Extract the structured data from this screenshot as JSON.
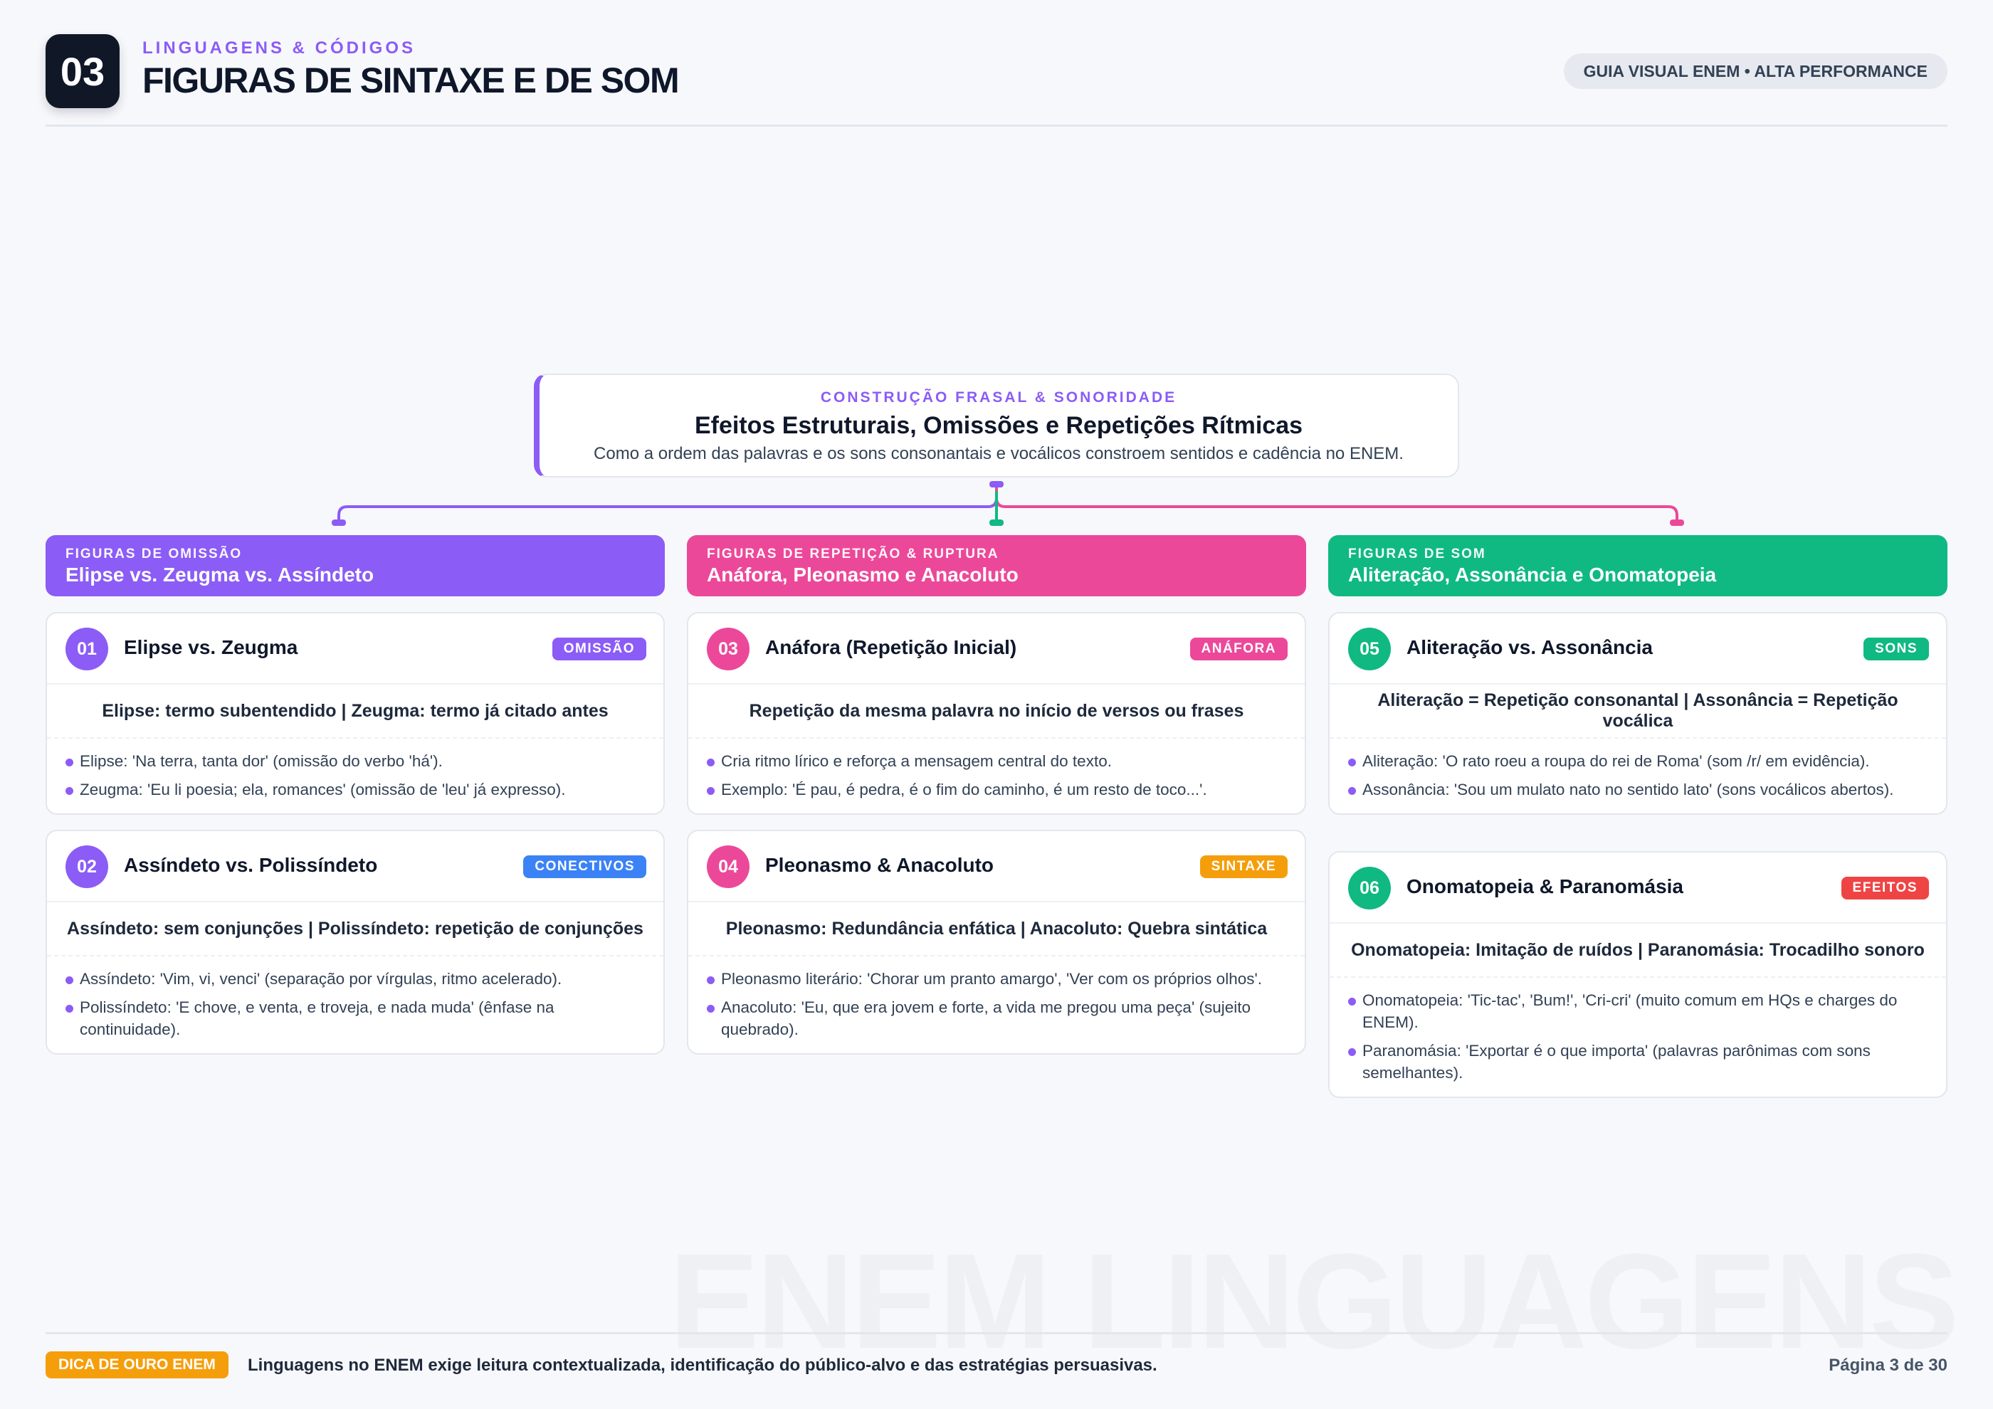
{
  "header": {
    "chapter_number": "03",
    "kicker": "LINGUAGENS & CÓDIGOS",
    "title": "FIGURAS DE SINTAXE E DE SOM",
    "guide_label": "GUIA VISUAL ENEM • ALTA PERFORMANCE"
  },
  "hero": {
    "kicker": "CONSTRUÇÃO FRASAL & SONORIDADE",
    "title": "Efeitos Estruturais, Omissões e Repetições Rítmicas",
    "description": "Como a ordem das palavras e os sons consonantais e vocálicos constroem sentidos e cadência no ENEM."
  },
  "colors": {
    "purple": "#8b5cf6",
    "pink": "#ec4899",
    "green": "#10b981",
    "blue": "#3b82f6",
    "orange": "#f59e0b",
    "red": "#ef4444"
  },
  "columns": [
    {
      "kicker": "FIGURAS DE OMISSÃO",
      "title": "Elipse vs. Zeugma vs. Assíndeto",
      "cards": [
        {
          "number": "01",
          "title": "Elipse vs. Zeugma",
          "tag": "OMISSÃO",
          "subtitle": "Elipse: termo subentendido | Zeugma: termo já citado antes",
          "bullets": [
            "Elipse: 'Na terra, tanta dor' (omissão do verbo 'há').",
            "Zeugma: 'Eu li poesia; ela, romances' (omissão de 'leu' já expresso)."
          ]
        },
        {
          "number": "02",
          "title": "Assíndeto vs. Polissíndeto",
          "tag": "CONECTIVOS",
          "subtitle": "Assíndeto: sem conjunções | Polissíndeto: repetição de conjunções",
          "bullets": [
            "Assíndeto: 'Vim, vi, venci' (separação por vírgulas, ritmo acelerado).",
            "Polissíndeto: 'E chove, e venta, e troveja, e nada muda' (ênfase na continuidade)."
          ]
        }
      ]
    },
    {
      "kicker": "FIGURAS DE REPETIÇÃO & RUPTURA",
      "title": "Anáfora, Pleonasmo e Anacoluto",
      "cards": [
        {
          "number": "03",
          "title": "Anáfora (Repetição Inicial)",
          "tag": "ANÁFORA",
          "subtitle": "Repetição da mesma palavra no início de versos ou frases",
          "bullets": [
            "Cria ritmo lírico e reforça a mensagem central do texto.",
            "Exemplo: 'É pau, é pedra, é o fim do caminho, é um resto de toco...'."
          ]
        },
        {
          "number": "04",
          "title": "Pleonasmo & Anacoluto",
          "tag": "SINTAXE",
          "subtitle": "Pleonasmo: Redundância enfática | Anacoluto: Quebra sintática",
          "bullets": [
            "Pleonasmo literário: 'Chorar um pranto amargo', 'Ver com os próprios olhos'.",
            "Anacoluto: 'Eu, que era jovem e forte, a vida me pregou uma peça' (sujeito quebrado)."
          ]
        }
      ]
    },
    {
      "kicker": "FIGURAS DE SOM",
      "title": "Aliteração, Assonância e Onomatopeia",
      "cards": [
        {
          "number": "05",
          "title": "Aliteração vs. Assonância",
          "tag": "SONS",
          "subtitle": "Aliteração = Repetição consonantal | Assonância = Repetição vocálica",
          "bullets": [
            "Aliteração: 'O rato roeu a roupa do rei de Roma' (som /r/ em evidência).",
            "Assonância: 'Sou um mulato nato no sentido lato' (sons vocálicos abertos)."
          ]
        },
        {
          "number": "06",
          "title": "Onomatopeia & Paranomásia",
          "tag": "EFEITOS",
          "subtitle": "Onomatopeia: Imitação de ruídos | Paranomásia: Trocadilho sonoro",
          "bullets": [
            "Onomatopeia: 'Tic-tac', 'Bum!', 'Cri-cri' (muito comum em HQs e charges do ENEM).",
            "Paranomásia: 'Exportar é o que importa' (palavras parônimas com sons semelhantes)."
          ]
        }
      ]
    }
  ],
  "watermark": "ENEM LINGUAGENS",
  "footer": {
    "tip_label": "DICA DE OURO ENEM",
    "tip_text": "Linguagens no ENEM exige leitura contextualizada, identificação do público-alvo e das estratégias persuasivas.",
    "page": "Página 3 de 30"
  }
}
